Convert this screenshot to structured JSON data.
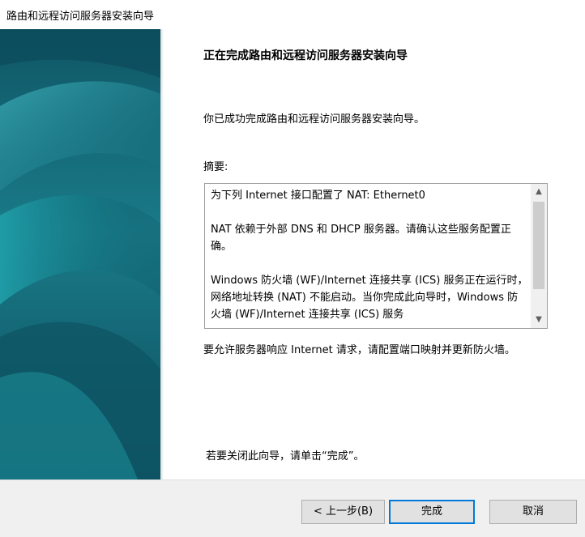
{
  "window": {
    "title": "路由和远程访问服务器安装向导"
  },
  "content": {
    "heading": "正在完成路由和远程访问服务器安装向导",
    "intro": "你已成功完成路由和远程访问服务器安装向导。",
    "summary_label": "摘要:",
    "summary_paragraphs": [
      "为下列 Internet 接口配置了 NAT: Ethernet0",
      "NAT 依赖于外部 DNS 和 DHCP 服务器。请确认这些服务配置正确。",
      "Windows 防火墙 (WF)/Internet 连接共享 (ICS) 服务正在运行时，网络地址转换 (NAT) 不能启动。当你完成此向导时，Windows 防火墙 (WF)/Internet 连接共享 (ICS) 服务"
    ],
    "note": "要允许服务器响应 Internet 请求，请配置端口映射并更新防火墙。",
    "finish_hint": "若要关闭此向导，请单击“完成”。"
  },
  "buttons": {
    "back": "< 上一步(B)",
    "finish": "完成",
    "cancel": "取消"
  },
  "colors": {
    "banner_dark": "#0b4f63",
    "banner_light": "#2a9aa6",
    "default_button_border": "#0078d7"
  }
}
